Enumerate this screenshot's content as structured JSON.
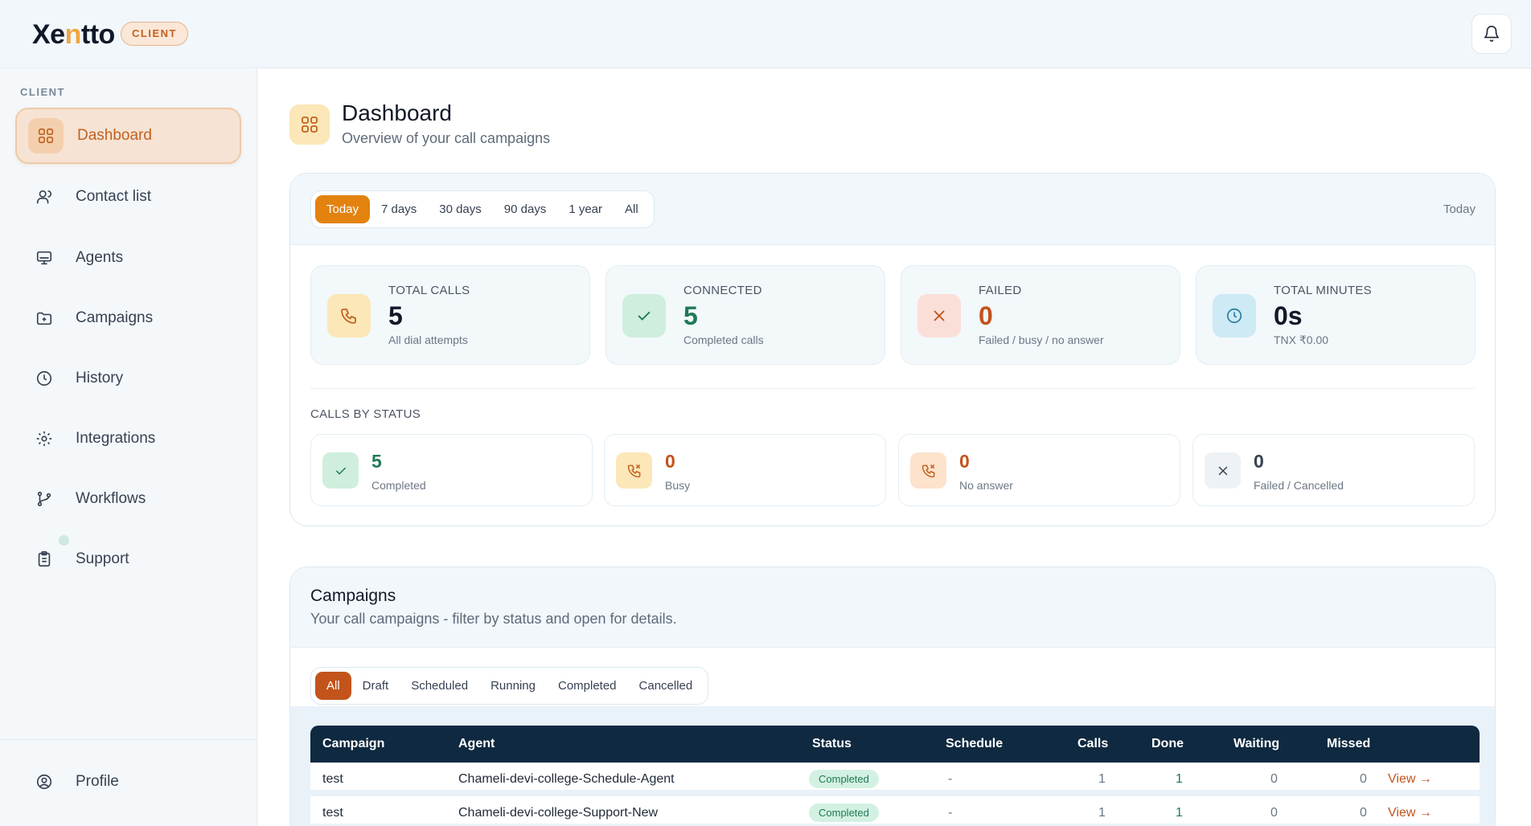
{
  "brand": {
    "logo_pre": "Xe",
    "logo_acc": "n",
    "logo_post": "tto",
    "role_badge": "CLIENT"
  },
  "sidebar": {
    "section": "CLIENT",
    "items": [
      {
        "label": "Dashboard",
        "icon": "grid-icon",
        "active": true
      },
      {
        "label": "Contact list",
        "icon": "users-icon"
      },
      {
        "label": "Agents",
        "icon": "monitor-icon"
      },
      {
        "label": "Campaigns",
        "icon": "folder-plus-icon"
      },
      {
        "label": "History",
        "icon": "clock-icon"
      },
      {
        "label": "Integrations",
        "icon": "gear-icon"
      },
      {
        "label": "Workflows",
        "icon": "git-branch-icon"
      },
      {
        "label": "Support",
        "icon": "clipboard-icon"
      }
    ],
    "profile": "Profile"
  },
  "header": {
    "title": "Dashboard",
    "subtitle": "Overview of your call campaigns"
  },
  "period": {
    "options": [
      "Today",
      "7 days",
      "30 days",
      "90 days",
      "1 year",
      "All"
    ],
    "selected": "Today",
    "current_label": "Today"
  },
  "stats": [
    {
      "label": "TOTAL CALLS",
      "value": "5",
      "note": "All dial attempts",
      "color": "#111827",
      "icon": "phone-icon"
    },
    {
      "label": "CONNECTED",
      "value": "5",
      "note": "Completed calls",
      "color": "#1e7a55",
      "icon": "check-icon"
    },
    {
      "label": "FAILED",
      "value": "0",
      "note": "Failed / busy / no answer",
      "color": "#c2541b",
      "icon": "x-icon"
    },
    {
      "label": "TOTAL MINUTES",
      "value": "0s",
      "note": "TNX ₹0.00",
      "color": "#111827",
      "icon": "clock-icon"
    }
  ],
  "calls_by_status": {
    "title": "CALLS BY STATUS",
    "items": [
      {
        "value": "5",
        "label": "Completed",
        "color": "#1e7a55",
        "icon": "check-icon"
      },
      {
        "value": "0",
        "label": "Busy",
        "color": "#c2541b",
        "icon": "phone-missed-icon"
      },
      {
        "value": "0",
        "label": "No answer",
        "color": "#c2541b",
        "icon": "phone-missed-icon"
      },
      {
        "value": "0",
        "label": "Failed / Cancelled",
        "color": "#374151",
        "icon": "x-icon"
      }
    ]
  },
  "campaigns": {
    "title": "Campaigns",
    "subtitle": "Your call campaigns - filter by status and open for details.",
    "filters": [
      "All",
      "Draft",
      "Scheduled",
      "Running",
      "Completed",
      "Cancelled"
    ],
    "selected_filter": "All",
    "columns": [
      "Campaign",
      "Agent",
      "Status",
      "Schedule",
      "Calls",
      "Done",
      "Waiting",
      "Missed"
    ],
    "rows": [
      {
        "campaign": "test",
        "agent": "Chameli-devi-college-Schedule-Agent",
        "status": "Completed",
        "schedule": "-",
        "calls": "1",
        "done": "1",
        "waiting": "0",
        "missed": "0",
        "action": "View →"
      },
      {
        "campaign": "test",
        "agent": "Chameli-devi-college-Support-New",
        "status": "Completed",
        "schedule": "-",
        "calls": "1",
        "done": "1",
        "waiting": "0",
        "missed": "0",
        "action": "View →"
      }
    ]
  }
}
